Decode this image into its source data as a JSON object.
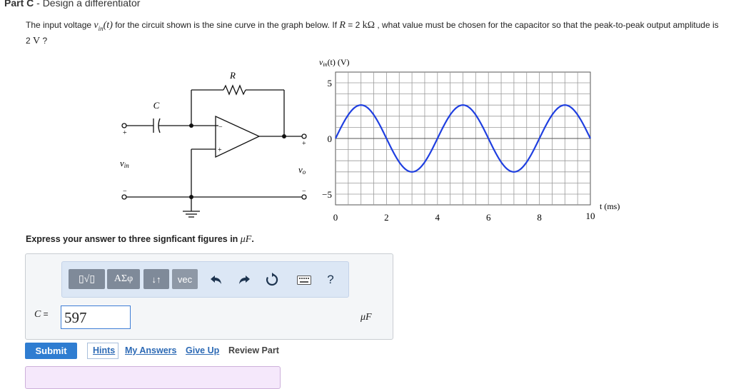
{
  "part": {
    "label": "Part C",
    "separator": " - ",
    "title": "Design a differentiator"
  },
  "question": {
    "t1": "The input voltage ",
    "v": "v",
    "vsub": "in",
    "vt": "(t)",
    "t2": " for the circuit shown is the sine curve in the graph below. If ",
    "R": "R",
    "t3": " = 2 ",
    "Runit": "kΩ",
    "t4": " , what value must be chosen for the capacitor so that the peak-to-peak output amplitude is 2 ",
    "Vunit": "V",
    "t5": " ?"
  },
  "circuit": {
    "r_label": "R",
    "c_label": "C",
    "vin_label": "v",
    "vin_sub": "in",
    "vo_label": "v",
    "vo_sub": "o",
    "plus": "+",
    "minus": "−"
  },
  "chart_data": {
    "type": "line",
    "ylabel_main": "v",
    "ylabel_sub": "in",
    "ylabel_rest": "(t) (V)",
    "xlabel": "t (ms)",
    "x_ticks": [
      "0",
      "2",
      "4",
      "6",
      "8",
      "10"
    ],
    "y_ticks": [
      "5",
      "0",
      "−5"
    ],
    "xlim": [
      0,
      10
    ],
    "ylim": [
      -5,
      5
    ],
    "grid": true,
    "series": [
      {
        "function": "sine",
        "amplitude": 3,
        "period_ms": 4,
        "phase_ms": 0,
        "x": [
          0,
          1,
          2,
          3,
          4,
          5,
          6,
          7,
          8,
          9,
          10
        ],
        "y": [
          0,
          3,
          0,
          -3,
          0,
          3,
          0,
          -3,
          0,
          3,
          0
        ]
      }
    ],
    "line_color": "#1f3fe0"
  },
  "instruction": {
    "text": "Express your answer to three signficant figures in ",
    "unit": "μF",
    "end": "."
  },
  "toolbar": {
    "templates_label": "▯√▯",
    "greek_label": "ΑΣφ",
    "arrows_label": "↓↑",
    "vec_label": "vec",
    "help_label": "?"
  },
  "answer": {
    "variable": "C",
    "equals": " = ",
    "value": "597",
    "unit": "μF"
  },
  "actions": {
    "submit": "Submit",
    "hints": "Hints",
    "my_answers": "My Answers",
    "give_up": "Give Up",
    "review": "Review Part"
  },
  "colors": {
    "accent": "#2f7dd1",
    "toolbar_bg": "#dce7f5",
    "button_gray": "#7f8a99",
    "feedback_bg": "#f5e8fb"
  }
}
